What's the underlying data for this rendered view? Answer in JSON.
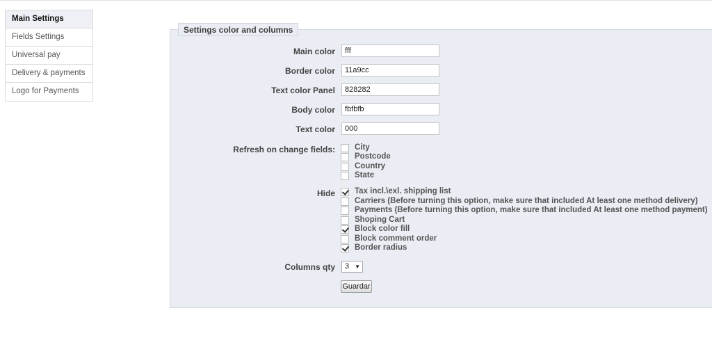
{
  "sidebar": {
    "items": [
      {
        "label": "Main Settings",
        "active": true
      },
      {
        "label": "Fields Settings"
      },
      {
        "label": "Universal pay"
      },
      {
        "label": "Delivery & payments"
      },
      {
        "label": "Logo for Payments"
      }
    ]
  },
  "panel": {
    "legend": "Settings color and columns",
    "fields": {
      "main_color": {
        "label": "Main color",
        "value": "fff"
      },
      "border_color": {
        "label": "Border color",
        "value": "11a9cc"
      },
      "text_color_panel": {
        "label": "Text color Panel",
        "value": "828282"
      },
      "body_color": {
        "label": "Body color",
        "value": "fbfbfb"
      },
      "text_color": {
        "label": "Text color",
        "value": "000"
      }
    },
    "refresh": {
      "label": "Refresh on change fields:",
      "options": [
        {
          "label": "City",
          "checked": false
        },
        {
          "label": "Postcode",
          "checked": false
        },
        {
          "label": "Country",
          "checked": false
        },
        {
          "label": "State",
          "checked": false
        }
      ]
    },
    "hide": {
      "label": "Hide",
      "options": [
        {
          "label": "Tax incl.\\exl. shipping list",
          "checked": true
        },
        {
          "label": "Carriers (Before turning this option, make sure that included At least one method delivery)",
          "checked": false
        },
        {
          "label": "Payments (Before turning this option, make sure that included At least one method payment)",
          "checked": false
        },
        {
          "label": "Shoping Cart",
          "checked": false
        },
        {
          "label": "Block color fill",
          "checked": true
        },
        {
          "label": "Block comment order",
          "checked": false
        },
        {
          "label": "Border radius",
          "checked": true
        }
      ]
    },
    "columns": {
      "label": "Columns qty",
      "value": "3"
    },
    "save_label": "Guardar"
  }
}
